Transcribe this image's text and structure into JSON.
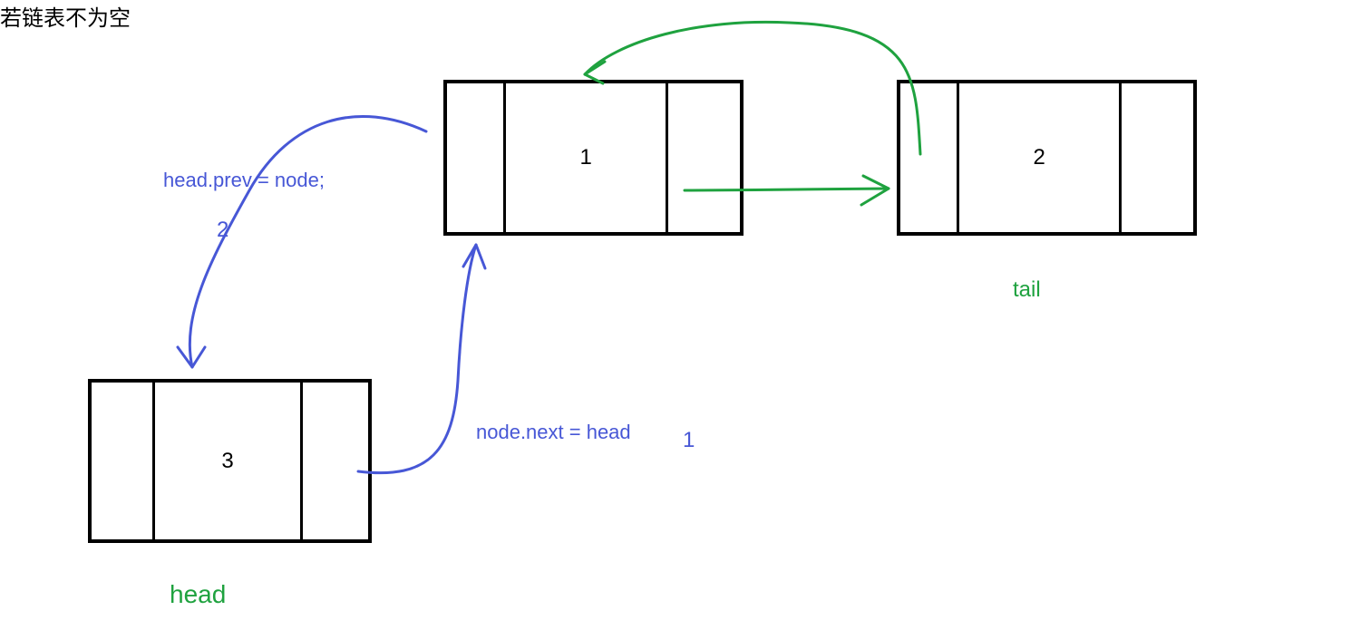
{
  "title": "若链表不为空",
  "nodes": {
    "node1": {
      "value": "1"
    },
    "node2": {
      "value": "2"
    },
    "node3": {
      "value": "3"
    }
  },
  "labels": {
    "head": "head",
    "tail": "tail",
    "op1_text": "head.prev = node;",
    "op1_step": "2",
    "op2_text": "node.next = head",
    "op2_step": "1"
  },
  "colors": {
    "blue": "#4757d6",
    "green": "#1fa23f",
    "black": "#000000"
  },
  "diagram_concept": "Inserting a new node (3) at the head of a non-empty doubly linked list containing nodes 1 and 2. Steps: (1) node.next = head, (2) head.prev = node. Existing forward/back links between node 1 and node 2 are drawn in green."
}
